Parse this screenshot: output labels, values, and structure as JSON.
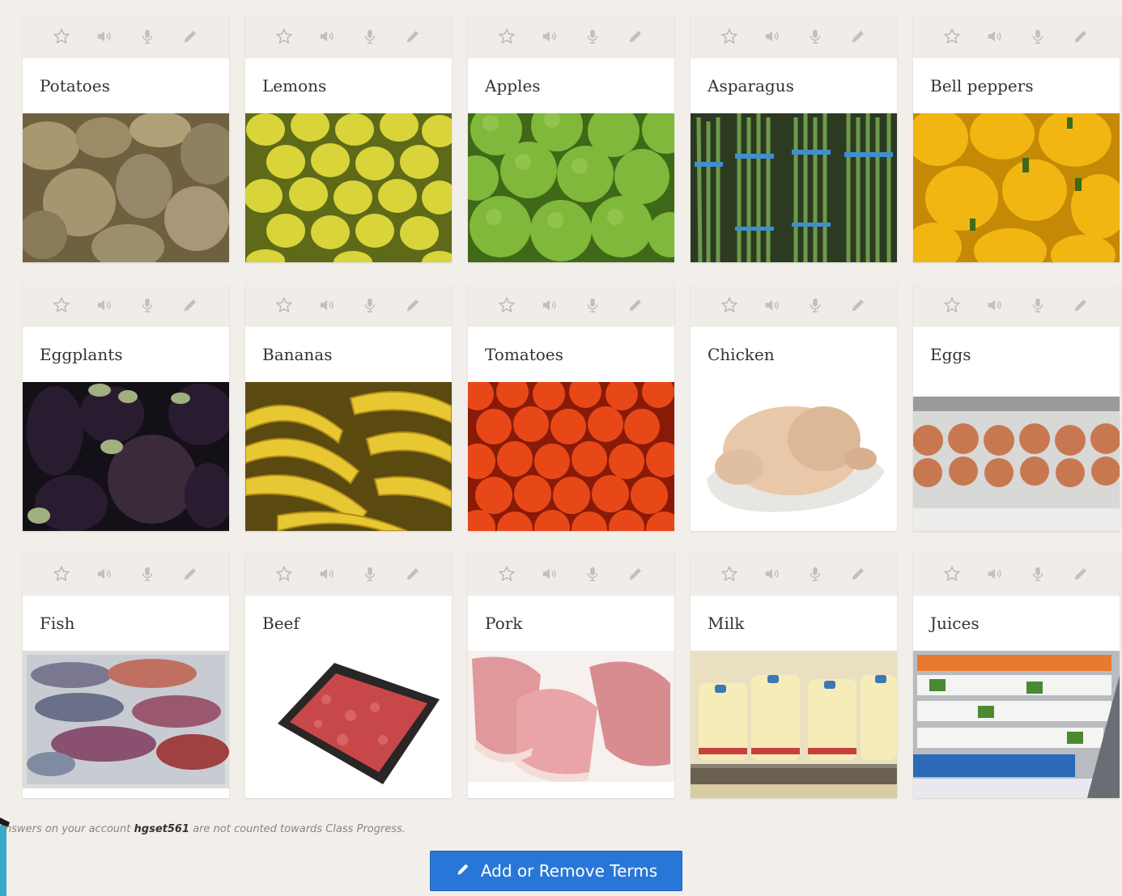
{
  "cards": [
    {
      "label": "Potatoes",
      "image": "potatoes-photo"
    },
    {
      "label": "Lemons",
      "image": "lemons-photo"
    },
    {
      "label": "Apples",
      "image": "apples-photo"
    },
    {
      "label": "Asparagus",
      "image": "asparagus-photo"
    },
    {
      "label": "Bell peppers",
      "image": "bell-peppers-photo"
    },
    {
      "label": "Eggplants",
      "image": "eggplants-photo"
    },
    {
      "label": "Bananas",
      "image": "bananas-photo"
    },
    {
      "label": "Tomatoes",
      "image": "tomatoes-photo"
    },
    {
      "label": "Chicken",
      "image": "chicken-photo"
    },
    {
      "label": "Eggs",
      "image": "eggs-photo"
    },
    {
      "label": "Fish",
      "image": "fish-photo"
    },
    {
      "label": "Beef",
      "image": "beef-photo"
    },
    {
      "label": "Pork",
      "image": "pork-photo"
    },
    {
      "label": "Milk",
      "image": "milk-photo"
    },
    {
      "label": "Juices",
      "image": "juices-photo"
    }
  ],
  "toolbar_icons": [
    "star-icon",
    "speaker-icon",
    "microphone-icon",
    "pencil-icon"
  ],
  "notice": {
    "prefix": "nswers on your account ",
    "account": "hgset561",
    "suffix": " are not counted towards Class Progress."
  },
  "add_button": {
    "label": "Add or Remove Terms",
    "icon": "pencil-icon"
  },
  "colors": {
    "accent": "#2877d8",
    "background": "#f2efea",
    "toolbar": "#f0ede8",
    "icon": "#b9b4ad"
  }
}
